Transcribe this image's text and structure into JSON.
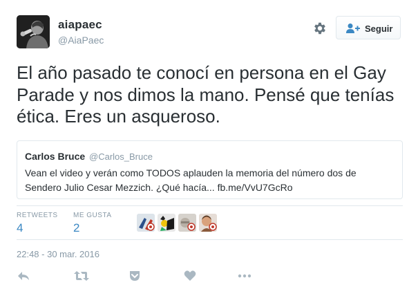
{
  "user": {
    "name": "aiapaec",
    "handle": "@AiaPaec",
    "avatar_icon": "singer-with-microphone-avatar"
  },
  "header": {
    "gear_icon": "gear-icon",
    "follow_label": "Seguir",
    "follow_icon": "person-plus-icon"
  },
  "tweet": {
    "text": "El año pasado te conocí en persona en el Gay Parade y nos dimos la mano. Pensé que tenías ética. Eres un asqueroso."
  },
  "quoted": {
    "name": "Carlos Bruce",
    "handle": "@Carlos_Bruce",
    "text": "Vean el video y verán como TODOS aplauden la memoria del número dos de Sendero Julio Cesar Mezzich. ¿Qué hacía... fb.me/VvU7GcRo"
  },
  "stats": {
    "retweets_label": "RETWEETS",
    "retweets_value": "4",
    "likes_label": "ME GUSTA",
    "likes_value": "2"
  },
  "timestamp": "22:48 - 30 mar. 2016",
  "actions": [
    "reply-icon",
    "retweet-icon",
    "pocket-icon",
    "like-heart-icon",
    "more-dots-icon"
  ],
  "colors": {
    "text": "#292f33",
    "muted": "#8899a6",
    "accent": "#3b88c3",
    "border": "#e1e8ed",
    "action_icon": "#aab8c2"
  }
}
